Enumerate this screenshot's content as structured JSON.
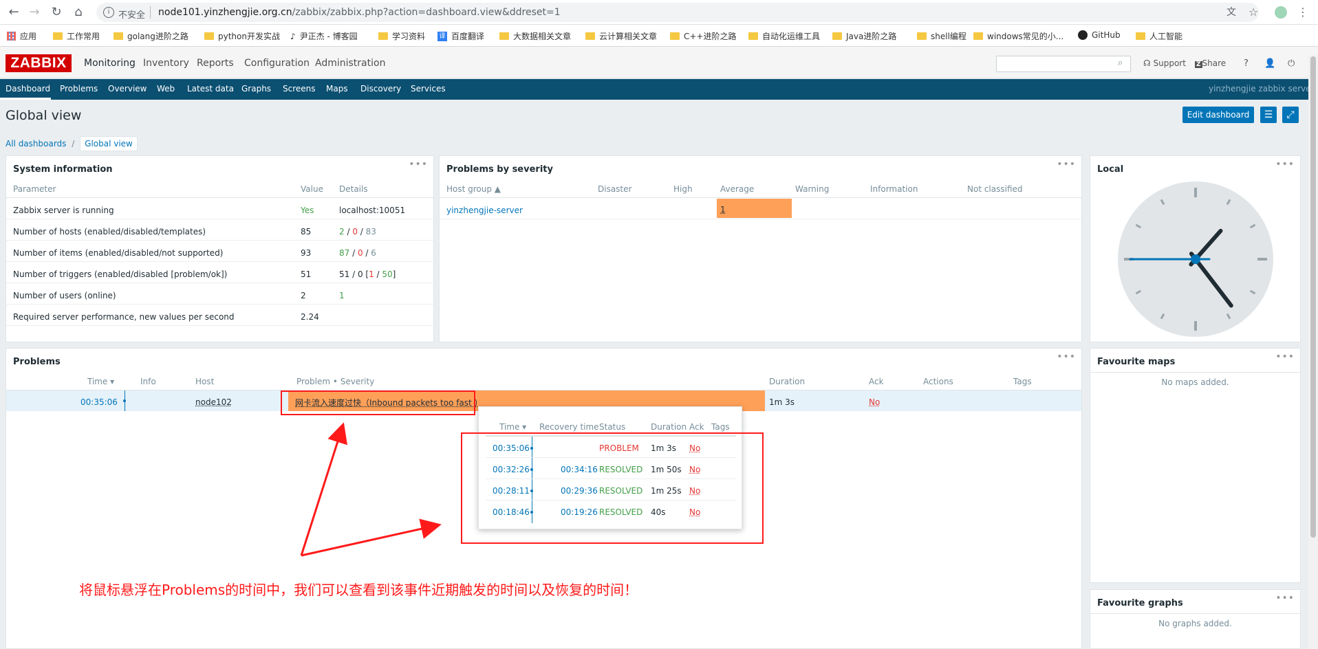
{
  "browser": {
    "insecure_label": "不安全",
    "url_host": "node101.yinzhengjie.org.cn",
    "url_path": "/zabbix/zabbix.php?action=dashboard.view&ddreset=1",
    "bookmarks": [
      "应用",
      "工作常用",
      "golang进阶之路",
      "python开发实战",
      "尹正杰 - 博客园",
      "学习资料",
      "百度翻译",
      "大数据相关文章",
      "云计算相关文章",
      "C++进阶之路",
      "自动化运维工具",
      "Java进阶之路",
      "shell编程",
      "windows常见的小...",
      "GitHub",
      "人工智能"
    ]
  },
  "header": {
    "logo": "ZABBIX",
    "menu": [
      "Monitoring",
      "Inventory",
      "Reports",
      "Configuration",
      "Administration"
    ],
    "support": "Support",
    "share": "Share",
    "help": "?",
    "server_name": "yinzhengjie zabbix server"
  },
  "subnav": [
    "Dashboard",
    "Problems",
    "Overview",
    "Web",
    "Latest data",
    "Graphs",
    "Screens",
    "Maps",
    "Discovery",
    "Services"
  ],
  "page": {
    "title": "Global view",
    "edit_button": "Edit dashboard",
    "breadcrumb_root": "All dashboards",
    "breadcrumb_sep": "/",
    "breadcrumb_current": "Global view"
  },
  "system_info": {
    "title": "System information",
    "headers": [
      "Parameter",
      "Value",
      "Details"
    ],
    "rows": [
      {
        "param": "Zabbix server is running",
        "value": "Yes",
        "details": "localhost:10051"
      },
      {
        "param": "Number of hosts (enabled/disabled/templates)",
        "value": "85",
        "d1": "2",
        "d2": "0",
        "d3": "83"
      },
      {
        "param": "Number of items (enabled/disabled/not supported)",
        "value": "93",
        "d1": "87",
        "d2": "0",
        "d3": "6"
      },
      {
        "param": "Number of triggers (enabled/disabled [problem/ok])",
        "value": "51",
        "d1": "51 / 0 [",
        "d2": "1",
        "d3": "50",
        "d4": "]"
      },
      {
        "param": "Number of users (online)",
        "value": "2",
        "details": "1"
      },
      {
        "param": "Required server performance, new values per second",
        "value": "2.24",
        "details": ""
      }
    ]
  },
  "severity": {
    "title": "Problems by severity",
    "headers": [
      "Host group ▲",
      "Disaster",
      "High",
      "Average",
      "Warning",
      "Information",
      "Not classified"
    ],
    "row": {
      "group": "yinzhengjie-server",
      "average": "1"
    }
  },
  "clock": {
    "title": "Local",
    "hour": 1,
    "minute": 23,
    "second": 45
  },
  "problems": {
    "title": "Problems",
    "headers": [
      "Time ▾",
      "Info",
      "Host",
      "Problem • Severity",
      "Duration",
      "Ack",
      "Actions",
      "Tags"
    ],
    "row": {
      "time": "00:35:06",
      "host": "node102",
      "problem": "网卡流入速度过快（Inbound packets too fast ）",
      "duration": "1m 3s",
      "ack": "No"
    }
  },
  "popup": {
    "headers": [
      "Time ▾",
      "Recovery time",
      "Status",
      "Duration",
      "Ack",
      "Tags"
    ],
    "rows": [
      {
        "time": "00:35:06",
        "recovery": "",
        "status": "PROBLEM",
        "duration": "1m 3s",
        "ack": "No"
      },
      {
        "time": "00:32:26",
        "recovery": "00:34:16",
        "status": "RESOLVED",
        "duration": "1m 50s",
        "ack": "No"
      },
      {
        "time": "00:28:11",
        "recovery": "00:29:36",
        "status": "RESOLVED",
        "duration": "1m 25s",
        "ack": "No"
      },
      {
        "time": "00:18:46",
        "recovery": "00:19:26",
        "status": "RESOLVED",
        "duration": "40s",
        "ack": "No"
      }
    ]
  },
  "fav_maps": {
    "title": "Favourite maps",
    "empty": "No maps added."
  },
  "fav_graphs": {
    "title": "Favourite graphs",
    "empty": "No graphs added."
  },
  "annotation": "将鼠标悬浮在Problems的时间中，我们可以查看到该事件近期触发的时间以及恢复的时间！",
  "colors": {
    "brand": "#d40000",
    "nav": "#0b4f71",
    "average": "#ffa059",
    "annotation": "#ff1a1a"
  }
}
